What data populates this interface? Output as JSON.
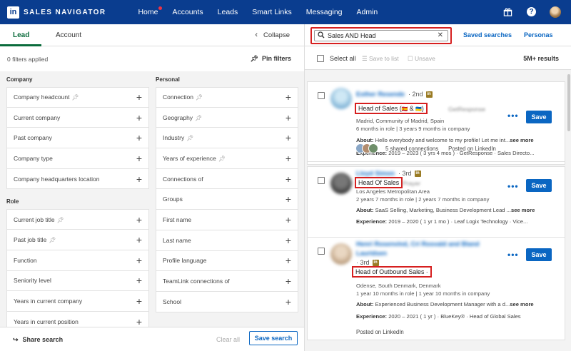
{
  "nav": {
    "logo": "in",
    "brand": "SALES NAVIGATOR",
    "items": [
      "Home",
      "Accounts",
      "Leads",
      "Smart Links",
      "Messaging",
      "Admin"
    ],
    "icons": [
      "gift-icon",
      "help-icon",
      "profile-avatar"
    ],
    "help_glyph": "?"
  },
  "left": {
    "tabs": {
      "lead": "Lead",
      "account": "Account"
    },
    "collapse": "Collapse",
    "filters_applied": "0 filters applied",
    "pin_filters": "Pin filters",
    "sections": {
      "company": "Company",
      "role": "Role",
      "personal": "Personal"
    },
    "company_filters": [
      "Company headcount",
      "Current company",
      "Past company",
      "Company type",
      "Company headquarters location"
    ],
    "role_filters": [
      "Current job title",
      "Past job title",
      "Function",
      "Seniority level",
      "Years in current company",
      "Years in current position"
    ],
    "personal_filters": [
      "Connection",
      "Geography",
      "Industry",
      "Years of experience",
      "Connections of",
      "Groups",
      "First name",
      "Last name",
      "Profile language",
      "TeamLink connections of",
      "School"
    ],
    "share_search": "Share search",
    "clear_all": "Clear all",
    "save_search": "Save search"
  },
  "right": {
    "search_value": "Sales AND Head",
    "saved_searches": "Saved searches",
    "personas": "Personas",
    "select_all": "Select all",
    "save_to_list": "Save to list",
    "unsave": "Unsave",
    "result_count": "5M+ results",
    "dots": "•••",
    "results": [
      {
        "name": "Esther Resende",
        "degree": "· 2nd",
        "title": "Head of Sales (",
        "title_blur": "GetResponse",
        "location": "Madrid, Community of Madrid, Spain",
        "tenure": "6 months in role | 3 years 9 months in company",
        "about_label": "About:",
        "about": "Hello everybody and welcome to my profile! Let me int...",
        "see_more": "see more",
        "exp_label": "Experience:",
        "exp": "2019 – 2023  ( 3 yrs 4 mos )  · GetResponse · Sales Directo...",
        "shared": "5 shared connections",
        "posted": "Posted on LinkedIn",
        "save": "Save"
      },
      {
        "name": "Lloyd Simon",
        "degree": "· 3rd",
        "title": "Head Of Sales",
        "title_blur": "Prayer",
        "location": "Los Angeles Metropolitan Area",
        "tenure": "2 years 7 months in role | 2 years 7 months in company",
        "about_label": "About:",
        "about": "SaaS Selling, Marketing, Business Development Lead ...",
        "see_more": "see more",
        "exp_label": "Experience:",
        "exp": "2019 – 2020  ( 1 yr 1 mo )  · Leaf Logix Technology · Vice...",
        "save": "Save"
      },
      {
        "name": "Henri Rosenvind, Cri Rosvald and Bland",
        "name2": "Lauridsen",
        "degree": "· 3rd",
        "title": "Head of Outbound Sales ·",
        "location": "Odense, South Denmark, Denmark",
        "tenure": "1 year 10 months in role | 1 year 10 months in company",
        "about_label": "About:",
        "about": "Experienced Business Development Manager with a d...",
        "see_more": "see more",
        "exp_label": "Experience:",
        "exp": "2020 – 2021  ( 1 yr )  · BlueKey® · Head of Global Sales",
        "posted": "Posted on LinkedIn",
        "save": "Save"
      }
    ]
  }
}
